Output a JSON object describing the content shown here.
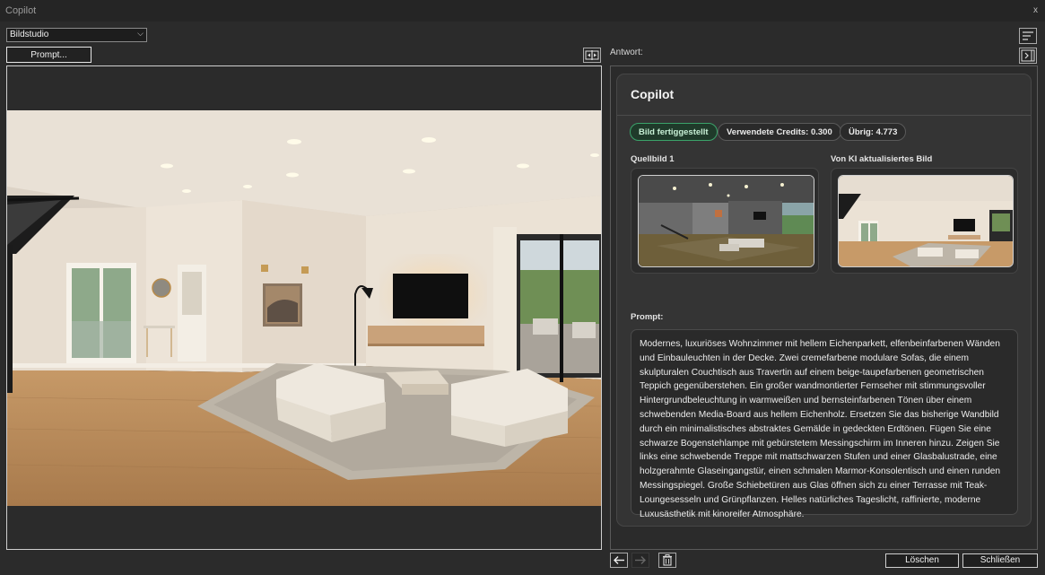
{
  "window": {
    "title": "Copilot",
    "close_glyph": "x"
  },
  "toolbar": {
    "mode_value": "Bildstudio",
    "prompt_button": "Prompt..."
  },
  "answer": {
    "label": "Antwort:",
    "card_title": "Copilot",
    "badges": {
      "status": "Bild fertiggestellt",
      "credits": "Verwendete Credits: 0.300",
      "remaining": "Übrig: 4.773"
    },
    "source_label": "Quellbild 1",
    "ai_label": "Von KI aktualisiertes Bild",
    "prompt_label": "Prompt:",
    "prompt_text": "Modernes, luxuriöses Wohnzimmer mit hellem Eichenparkett, elfenbeinfarbenen Wänden und Einbauleuchten in der Decke. Zwei cremefarbene modulare Sofas, die einem skulpturalen Couchtisch aus Travertin auf einem beige-taupefarbenen geometrischen Teppich gegenüberstehen. Ein großer wandmontierter Fernseher mit stimmungsvoller Hintergrundbeleuchtung in warmweißen und bernsteinfarbenen Tönen über einem schwebenden Media-Board aus hellem Eichenholz. Ersetzen Sie das bisherige Wandbild durch ein minimalistisches abstraktes Gemälde in gedeckten Erdtönen. Fügen Sie eine schwarze Bogenstehlampe mit gebürstetem Messingschirm im Inneren hinzu. Zeigen Sie links eine schwebende Treppe mit mattschwarzen Stufen und einer Glasbalustrade, eine holzgerahmte Glaseingangstür, einen schmalen Marmor-Konsolentisch und einen runden Messingspiegel. Große Schiebetüren aus Glas öffnen sich zu einer Terrasse mit Teak-Loungesesseln und Grünpflanzen. Helles natürliches Tageslicht, raffinierte, moderne Luxusästhetik mit kinoreifer Atmosphäre."
  },
  "footer": {
    "delete_button": "Löschen",
    "close_button": "Schließen"
  },
  "icons": {
    "select_chevron": "chevron-down-icon",
    "split": "split-view-icon",
    "menu": "sort-lines-icon",
    "collapse": "collapse-right-icon",
    "back": "arrow-left-icon",
    "forward": "arrow-right-icon",
    "trash": "trash-icon"
  },
  "colors": {
    "background": "#2b2b2b",
    "card": "#343434",
    "status_green": "#3ba36a"
  }
}
